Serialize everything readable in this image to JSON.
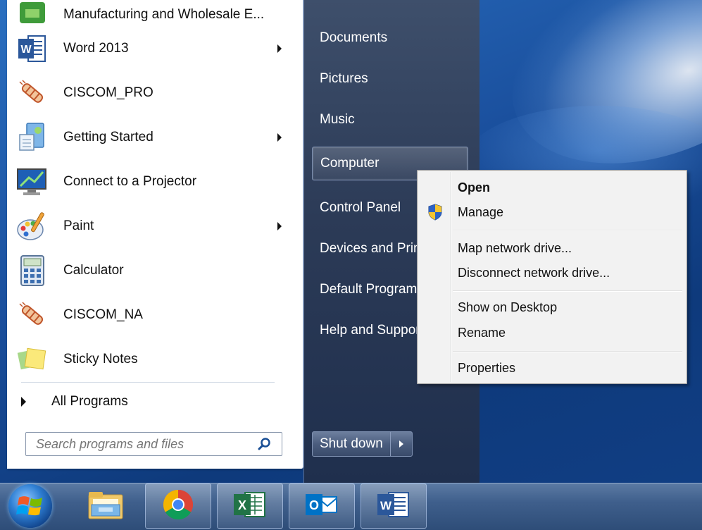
{
  "programs": [
    {
      "label": "Manufacturing and Wholesale E...",
      "icon": "manufacturing-app-icon",
      "has_submenu": false
    },
    {
      "label": "Word 2013",
      "icon": "word-icon",
      "has_submenu": true
    },
    {
      "label": "CISCOM_PRO",
      "icon": "ciscom-pen-icon",
      "has_submenu": false
    },
    {
      "label": "Getting Started",
      "icon": "getting-started-icon",
      "has_submenu": true
    },
    {
      "label": "Connect to a Projector",
      "icon": "projector-icon",
      "has_submenu": false
    },
    {
      "label": "Paint",
      "icon": "paint-palette-icon",
      "has_submenu": true
    },
    {
      "label": "Calculator",
      "icon": "calculator-icon",
      "has_submenu": false
    },
    {
      "label": "CISCOM_NA",
      "icon": "ciscom-pen-icon",
      "has_submenu": false
    },
    {
      "label": "Sticky Notes",
      "icon": "sticky-notes-icon",
      "has_submenu": false
    }
  ],
  "all_programs_label": "All Programs",
  "search": {
    "placeholder": "Search programs and files",
    "icon": "search-icon"
  },
  "right_links": [
    {
      "label": "Documents"
    },
    {
      "label": "Pictures"
    },
    {
      "label": "Music"
    },
    {
      "label": "Computer"
    },
    {
      "label": "Control Panel"
    },
    {
      "label": "Devices and Printers"
    },
    {
      "label": "Default Programs"
    },
    {
      "label": "Help and Support"
    }
  ],
  "shutdown": {
    "label": "Shut down",
    "arrow_icon": "chevron-right-icon"
  },
  "context_menu": {
    "items": [
      {
        "label": "Open",
        "bold": true
      },
      {
        "label": "Manage",
        "icon": "uac-shield-icon"
      },
      {
        "label": "Map network drive..."
      },
      {
        "label": "Disconnect network drive..."
      },
      {
        "label": "Show on Desktop"
      },
      {
        "label": "Rename"
      },
      {
        "label": "Properties"
      }
    ]
  },
  "taskbar": {
    "start_icon": "windows-orb-icon",
    "apps": [
      {
        "name": "File Explorer",
        "icon": "file-explorer-icon"
      },
      {
        "name": "Google Chrome",
        "icon": "chrome-icon"
      },
      {
        "name": "Excel",
        "icon": "excel-icon"
      },
      {
        "name": "Outlook",
        "icon": "outlook-icon"
      },
      {
        "name": "Word",
        "icon": "word-icon"
      }
    ]
  },
  "colors": {
    "word_blue": "#2b579a",
    "excel_green": "#217346",
    "outlook_blue": "#0072c6"
  }
}
